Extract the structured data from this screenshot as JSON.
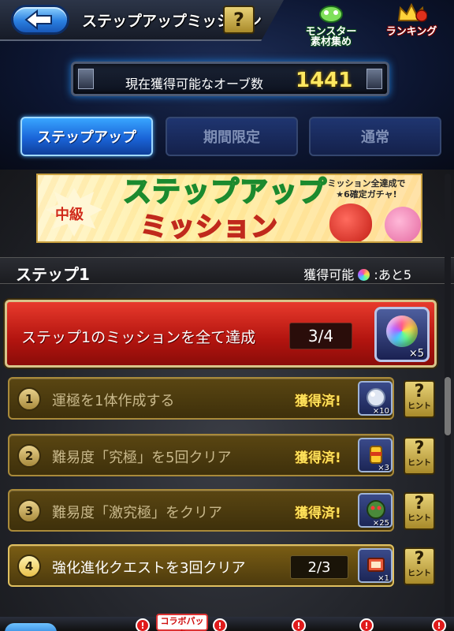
{
  "header": {
    "title": "ステップアップミッション",
    "help_label": "?",
    "monster_collect_label": "モンスター\n素材集め",
    "ranking_label": "ランキング"
  },
  "orb_panel": {
    "label": "現在獲得可能なオーブ数",
    "count": "1441"
  },
  "tabs": [
    {
      "label": "ステップアップ",
      "active": true
    },
    {
      "label": "期間限定",
      "active": false
    },
    {
      "label": "通常",
      "active": false
    }
  ],
  "banner": {
    "badge": "中級",
    "title_line1": "ステップアップ",
    "title_line2": "ミッション",
    "side_text": "ミッション全達成で\n★6確定ガチャ!"
  },
  "step": {
    "title": "ステップ1",
    "remain_prefix": "獲得可能",
    "remain_suffix": ":あと5"
  },
  "main_mission": {
    "text": "ステップ1のミッションを全て達成",
    "progress": "3/4",
    "reward_qty": "×5"
  },
  "missions": [
    {
      "num": "1",
      "text": "運極を1体作成する",
      "status": "獲得済!",
      "reward_qty": "×10",
      "hint": "ヒント"
    },
    {
      "num": "2",
      "text": "難易度「究極」を5回クリア",
      "status": "獲得済!",
      "reward_qty": "×3",
      "hint": "ヒント"
    },
    {
      "num": "3",
      "text": "難易度「激究極」をクリア",
      "status": "獲得済!",
      "reward_qty": "×25",
      "hint": "ヒント"
    },
    {
      "num": "4",
      "text": "強化進化クエストを3回クリア",
      "progress": "2/3",
      "reward_qty": "×1",
      "hint": "ヒント"
    }
  ],
  "hint_icon_label": "?",
  "bottom": {
    "collab_label": "コラボパック",
    "alert_symbol": "!"
  },
  "colors": {
    "active_tab": "#1a64d8",
    "main_step_red": "#b2140f",
    "orb_count_yellow": "#ffe860",
    "acquired_yellow": "#ffe25a"
  }
}
